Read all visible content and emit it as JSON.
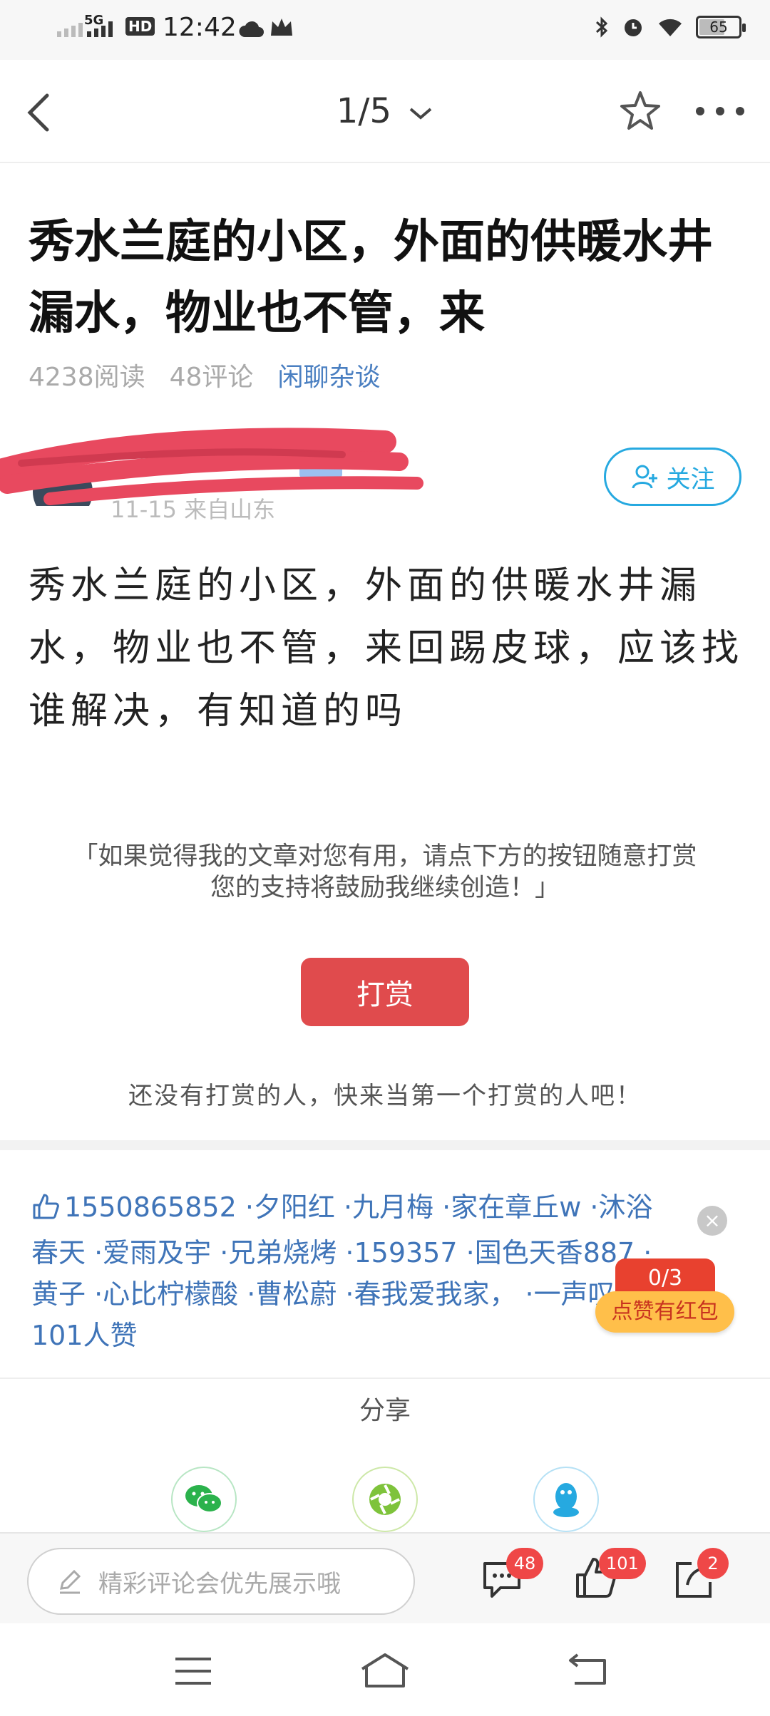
{
  "status_bar": {
    "time": "12:42",
    "network": "5G",
    "hd": "HD",
    "battery": "65"
  },
  "nav": {
    "pager": "1/5"
  },
  "post": {
    "title": "秀水兰庭的小区，外面的供暖水井漏水，物业也不管，来",
    "reads": "4238阅读",
    "comments": "48评论",
    "category": "闲聊杂谈",
    "author_sub": "11-15  来自山东",
    "follow_label": "关注",
    "body": "秀水兰庭的小区，外面的供暖水井漏水，物业也不管，来回踢皮球，应该找谁解决，有知道的吗"
  },
  "reward": {
    "note_line1": "「如果觉得我的文章对您有用，请点下方的按钮随意打赏",
    "note_line2": "您的支持将鼓励我继续创造！」",
    "button": "打赏",
    "empty": "还没有打赏的人，快来当第一个打赏的人吧！"
  },
  "likes": {
    "text": "1550865852 ·夕阳红 ·九月梅 ·家在章丘w ·沐浴春天 ·爱雨及宇 ·兄弟烧烤 ·159357 ·国色天香887 ·黄子 ·心比柠檬酸 ·曹松蔚 ·春我爱我家， ·一声叹息等101人赞",
    "close": "×",
    "redpack_progress": "0/3",
    "redpack_label": "点赞有红包"
  },
  "share": {
    "title": "分享",
    "items": [
      "wechat-icon",
      "moments-icon",
      "qq-icon"
    ],
    "colors": {
      "wechat": "#2bb24c",
      "moments": "#7ec33b",
      "qq": "#26a9e0"
    }
  },
  "comment_bar": {
    "placeholder": "精彩评论会优先展示哦",
    "comment_count": "48",
    "like_count": "101",
    "share_count": "2"
  },
  "colors": {
    "accent_blue": "#26a9e0",
    "reward_red": "#e04b4d",
    "link_blue": "#3f74b8",
    "badge_red": "#ef4747"
  }
}
